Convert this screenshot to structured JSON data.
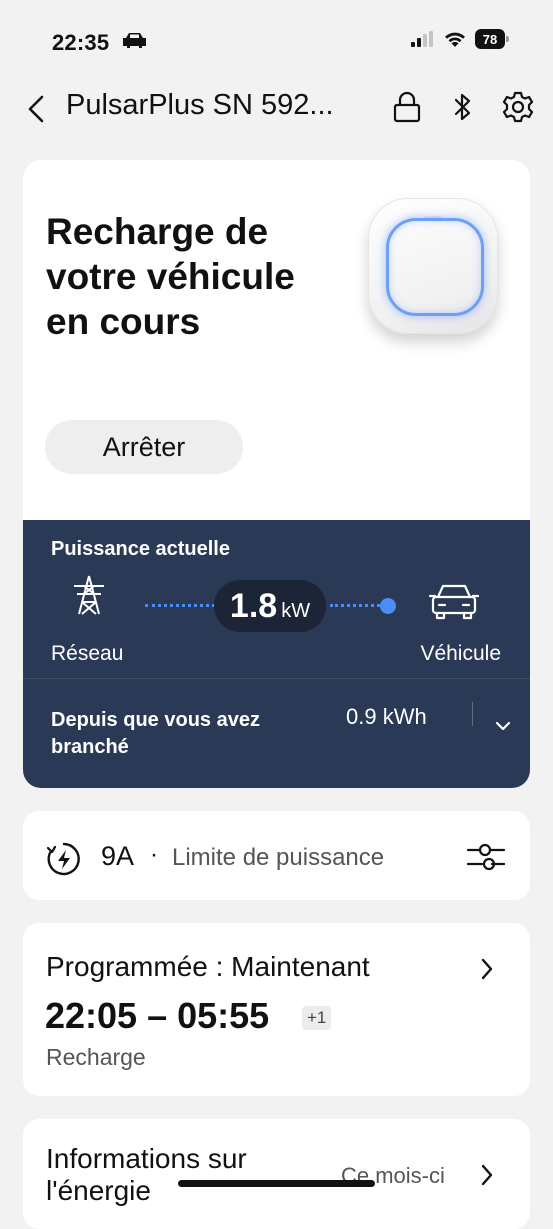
{
  "status_bar": {
    "time": "22:35",
    "battery": "78"
  },
  "nav": {
    "title": "PulsarPlus SN 592..."
  },
  "hero": {
    "title": "Recharge de votre véhicule en cours",
    "stop_label": "Arrêter"
  },
  "power": {
    "label": "Puissance actuelle",
    "value": "1.8",
    "unit": "kW",
    "source_label": "Réseau",
    "target_label": "Véhicule",
    "since_label": "Depuis que vous avez branché",
    "energy": "0.9 kWh"
  },
  "limit": {
    "amps": "9A",
    "separator": "·",
    "label": "Limite de puissance"
  },
  "schedule": {
    "title": "Programmée :  Maintenant",
    "time_range": "22:05 – 05:55",
    "day_offset": "+1",
    "subtitle": "Recharge"
  },
  "info": {
    "title": "Informations sur l'énergie",
    "period": "Ce mois-ci"
  },
  "colors": {
    "accent": "#4c8cf7",
    "panel": "#2a3a56",
    "ring": "#6f9ef5"
  }
}
